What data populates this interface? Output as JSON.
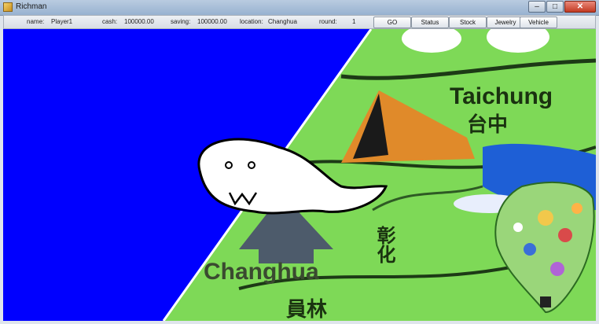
{
  "window": {
    "title": "Richman"
  },
  "status": {
    "name_label": "name:",
    "name_value": "Player1",
    "cash_label": "cash:",
    "cash_value": "100000.00",
    "saving_label": "saving:",
    "saving_value": "100000.00",
    "location_label": "location:",
    "location_value": "Changhua",
    "round_label": "round:",
    "round_value": "1"
  },
  "buttons": {
    "go": "GO",
    "status": "Status",
    "stock": "Stock",
    "jewelry": "Jewelry",
    "vehicle": "Vehicle"
  },
  "map": {
    "city_label_top": "Taichung",
    "city_label_top_cn": "台中",
    "city_label_bottom": "Changhua",
    "side_cn": "彰化",
    "bottom_cn": "員林"
  },
  "colors": {
    "sea": "#0000ff",
    "land": "#7ed957",
    "ghost": "#ffffff",
    "mountain": "#e08a2a"
  }
}
